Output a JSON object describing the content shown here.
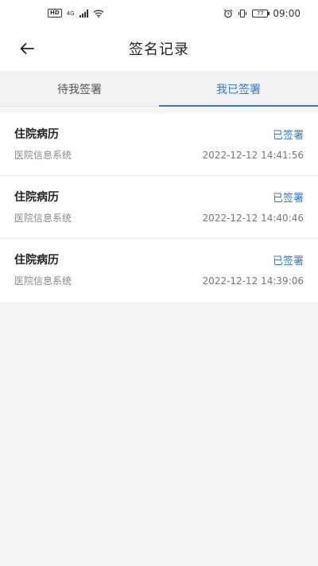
{
  "status_bar": {
    "hd": "HD",
    "network": "4G",
    "battery": "77",
    "time": "09:00"
  },
  "header": {
    "title": "签名记录",
    "back_icon": "arrow-left-icon"
  },
  "tabs": [
    {
      "label": "待我签署",
      "active": false
    },
    {
      "label": "我已签署",
      "active": true
    }
  ],
  "records": [
    {
      "title": "住院病历",
      "status": "已签署",
      "source": "医院信息系统",
      "time": "2022-12-12 14:41:56"
    },
    {
      "title": "住院病历",
      "status": "已签署",
      "source": "医院信息系统",
      "time": "2022-12-12 14:40:46"
    },
    {
      "title": "住院病历",
      "status": "已签署",
      "source": "医院信息系统",
      "time": "2022-12-12 14:39:06"
    }
  ],
  "colors": {
    "accent": "#2e7bd1",
    "background": "#f5f5f7"
  }
}
